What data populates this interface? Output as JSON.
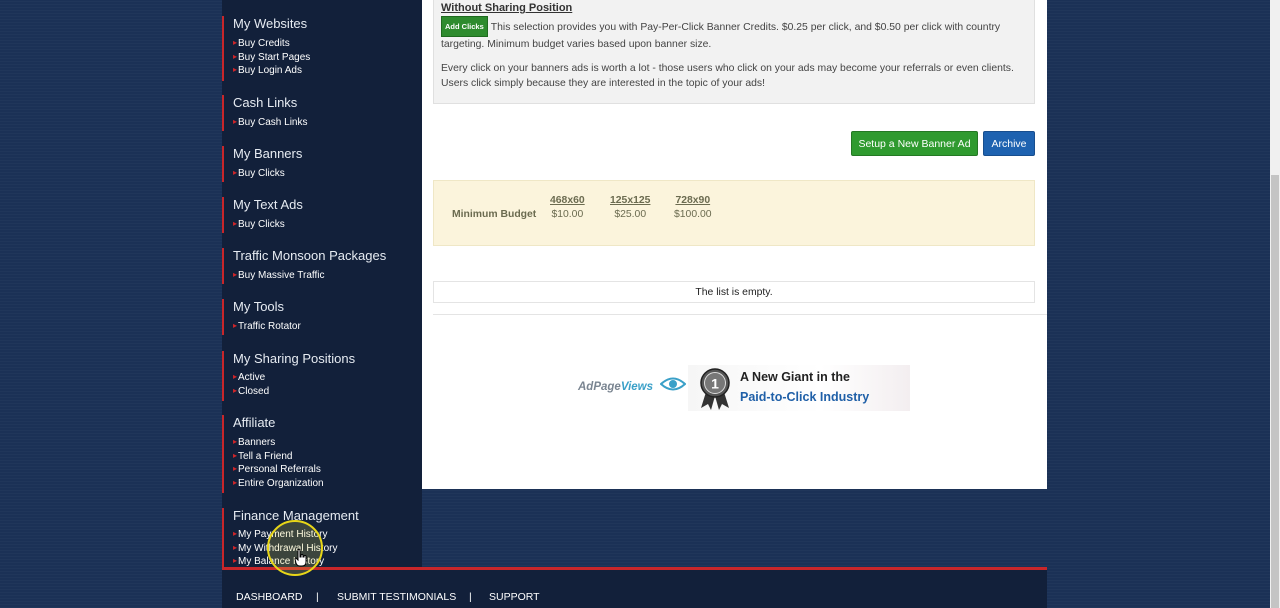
{
  "sidebar": {
    "sections": [
      {
        "title": "My Websites",
        "links": [
          "Buy Credits",
          "Buy Start Pages",
          "Buy Login Ads"
        ]
      },
      {
        "title": "Cash Links",
        "links": [
          "Buy Cash Links"
        ]
      },
      {
        "title": "My Banners",
        "links": [
          "Buy Clicks"
        ]
      },
      {
        "title": "My Text Ads",
        "links": [
          "Buy Clicks"
        ]
      },
      {
        "title": "Traffic Monsoon Packages",
        "links": [
          "Buy Massive Traffic"
        ]
      },
      {
        "title": "My Tools",
        "links": [
          "Traffic Rotator"
        ]
      },
      {
        "title": "My Sharing Positions",
        "links": [
          "Active",
          "Closed"
        ]
      },
      {
        "title": "Affiliate",
        "links": [
          "Banners",
          "Tell a Friend",
          "Personal Referrals",
          "Entire Organization"
        ]
      },
      {
        "title": "Finance Management",
        "links": [
          "My Payment History",
          "My Withdrawal History",
          "My Balance History"
        ]
      }
    ]
  },
  "info": {
    "heading": "Without Sharing Position",
    "badge": "Add Clicks",
    "paragraph1": "This selection provides you with Pay-Per-Click Banner Credits. $0.25 per click, and $0.50 per click with country targeting. Minimum budget varies based upon banner size.",
    "paragraph2": "Every click on your banners ads is worth a lot - those users who click on your ads may become your referrals or even clients. Users click simply because they are interested in the topic of your ads!"
  },
  "actions": {
    "setup_label": "Setup a New Banner Ad",
    "archive_label": "Archive"
  },
  "budget": {
    "label": "Minimum Budget",
    "sizes": [
      {
        "size": "468x60",
        "price": "$10.00"
      },
      {
        "size": "125x125",
        "price": "$25.00"
      },
      {
        "size": "728x90",
        "price": "$100.00"
      }
    ]
  },
  "list": {
    "empty_text": "The list is empty."
  },
  "ad": {
    "logo_main": "AdPage",
    "logo_accent": "Views",
    "medal_number": "1",
    "line1": "A New Giant in the",
    "line2": "Paid-to-Click Industry"
  },
  "footer": {
    "links": [
      "DASHBOARD",
      "SUBMIT TESTIMONIALS",
      "SUPPORT"
    ],
    "separator": "|"
  },
  "colors": {
    "page_bg": "#1b3156",
    "sidebar_bg": "#12203a",
    "accent_red": "#c8262a",
    "setup_green": "#2f9a2f",
    "archive_blue": "#1e62b0",
    "budget_bg": "#fbf4dc"
  }
}
